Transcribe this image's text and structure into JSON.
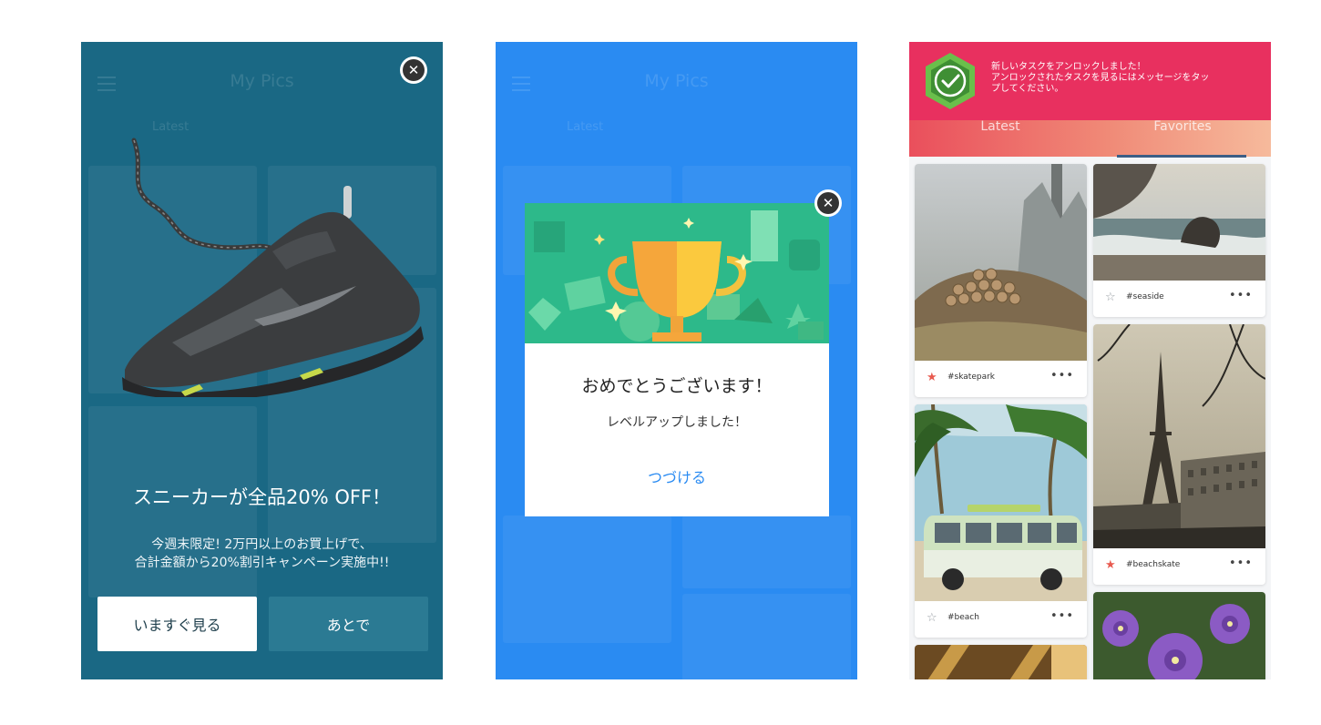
{
  "screens": {
    "promo": {
      "close_glyph": "✕",
      "title": "スニーカーが全品20% OFF！",
      "body_line1": "今週末限定! 2万円以上のお買上げで、",
      "body_line2": "合計金額から20%割引キャンペーン実施中!!",
      "primary_button": "いますぐ見る",
      "secondary_button": "あとで",
      "bg_app_title": "My Pics",
      "bg_tab_latest": "Latest",
      "background_color": "#1a6884"
    },
    "achievement": {
      "close_glyph": "✕",
      "title": "おめでとうございます！",
      "subtitle": "レベルアップしました！",
      "action": "つづける",
      "bg_app_title": "My Pics",
      "bg_tab_latest": "Latest",
      "background_color": "#2a8bf2",
      "accent_color": "#2a8bf2"
    },
    "feed": {
      "notification": {
        "line1": "新しいタスクをアンロックしました！",
        "line2": "アンロックされたタスクを見るにはメッセージをタッ",
        "line3": "プしてください。",
        "background_color": "#e8305f"
      },
      "tabs": {
        "latest": "Latest",
        "favorites": "Favorites"
      },
      "cards": [
        {
          "tag": "#skatepark",
          "favorited": true,
          "icon": "star-filled-icon"
        },
        {
          "tag": "#seaside",
          "favorited": false,
          "icon": "star-outline-icon"
        },
        {
          "tag": "#beachskate",
          "favorited": true,
          "icon": "star-filled-icon"
        },
        {
          "tag": "#beach",
          "favorited": false,
          "icon": "star-outline-icon"
        }
      ],
      "more_glyph": "•••"
    }
  }
}
